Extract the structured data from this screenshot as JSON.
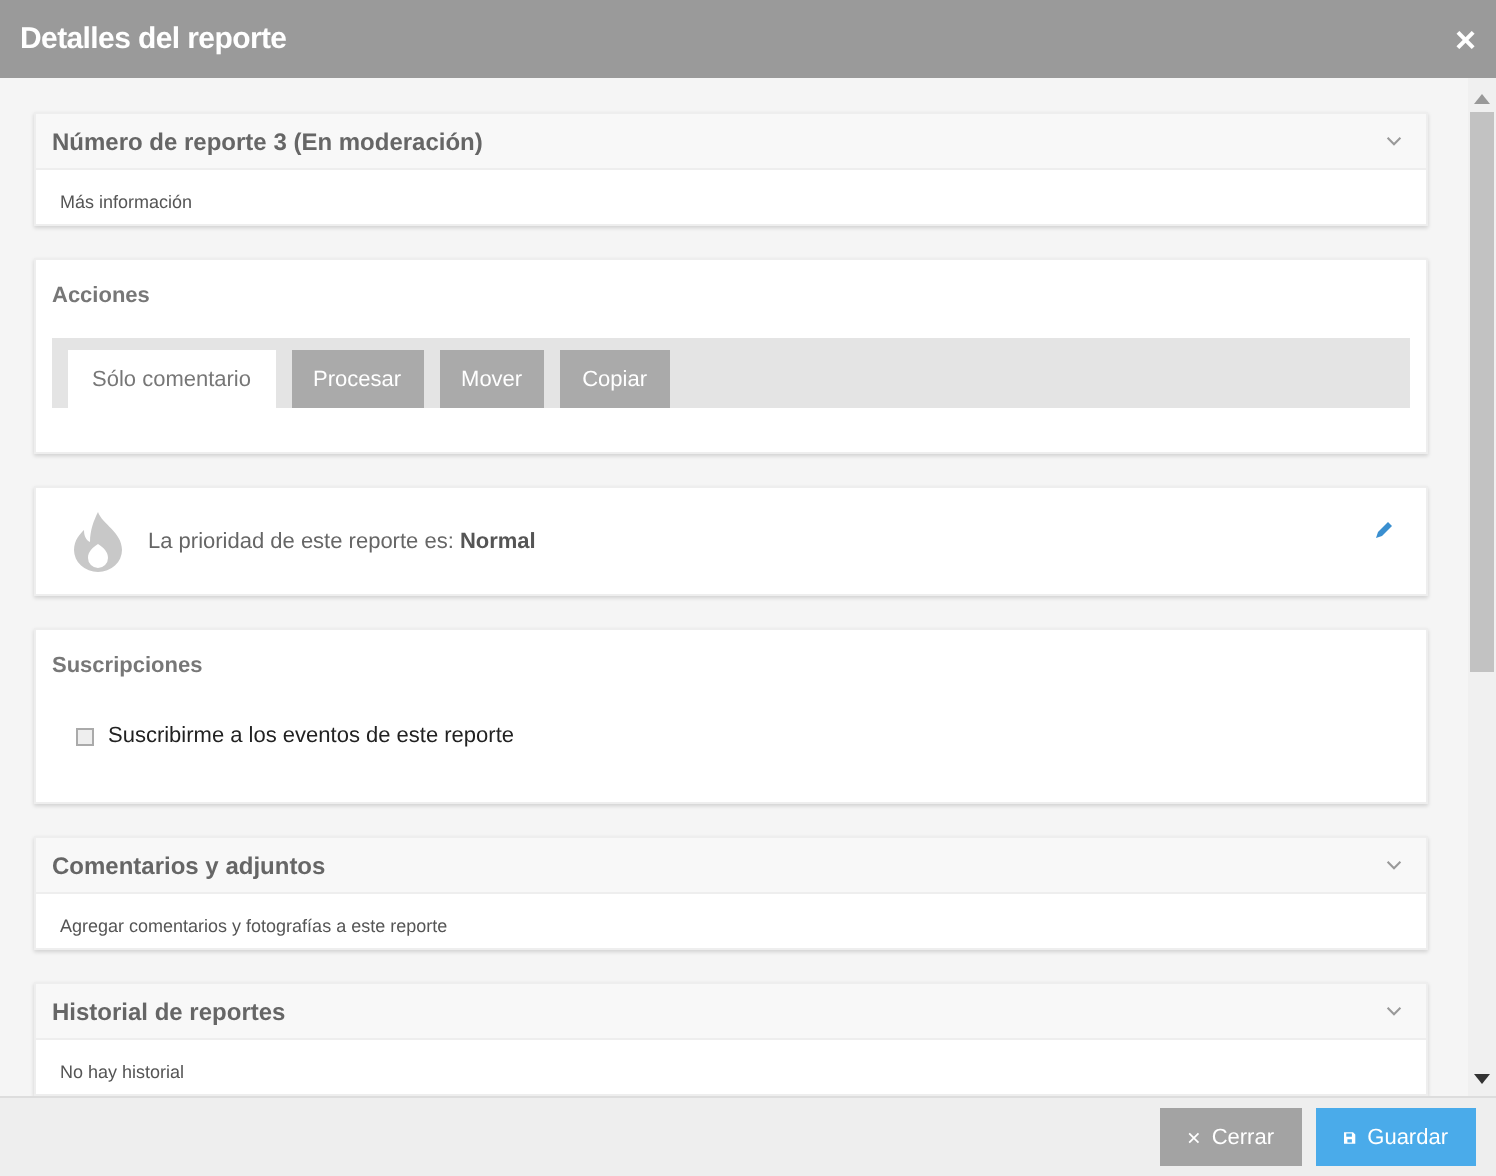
{
  "window": {
    "title": "Detalles del reporte",
    "close": "×"
  },
  "sections": [
    {
      "kind": "collapsible",
      "title": "Número de reporte 3 (En moderación)",
      "body": "Más información"
    },
    {
      "kind": "actions",
      "title": "Acciones",
      "tabs": [
        {
          "label": "Sólo comentario",
          "selected": true
        },
        {
          "label": "Procesar",
          "selected": false
        },
        {
          "label": "Mover",
          "selected": false
        },
        {
          "label": "Copiar",
          "selected": false
        }
      ]
    },
    {
      "kind": "priority",
      "text": "La prioridad de este reporte es: **Normal**"
    },
    {
      "kind": "subscriptions",
      "title": "Suscripciones",
      "checkbox": {
        "label": "Suscribirme a los eventos de este reporte",
        "checked": false
      }
    },
    {
      "kind": "collapsible",
      "title": "Comentarios y adjuntos",
      "body": "Agregar comentarios y fotografías a este reporte"
    },
    {
      "kind": "collapsible",
      "title": "Historial de reportes",
      "body": "No hay historial"
    }
  ],
  "footer": {
    "buttons": [
      {
        "label": "Cerrar",
        "kind": "close"
      },
      {
        "label": "Guardar",
        "kind": "save"
      }
    ]
  }
}
